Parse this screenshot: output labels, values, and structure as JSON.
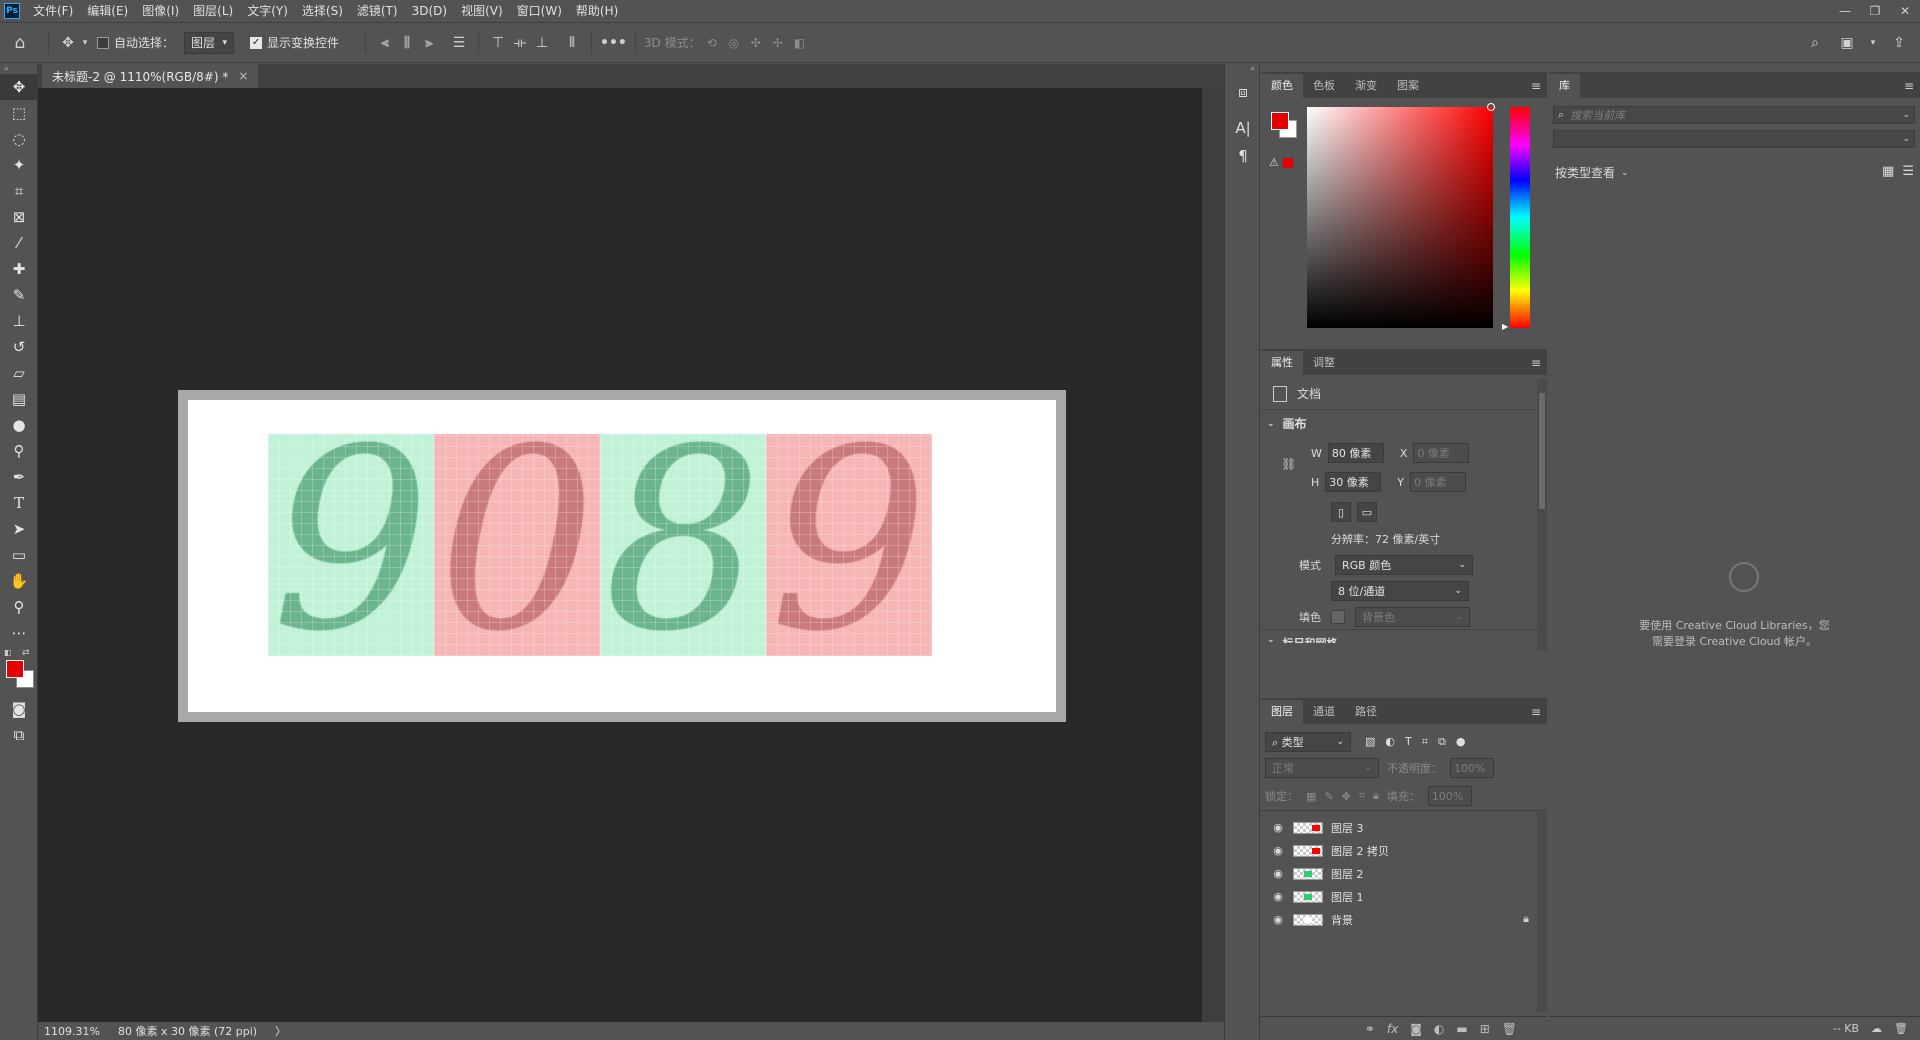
{
  "app": {
    "logo_text": "Ps"
  },
  "menu": [
    "文件(F)",
    "编辑(E)",
    "图像(I)",
    "图层(L)",
    "文字(Y)",
    "选择(S)",
    "滤镜(T)",
    "3D(D)",
    "视图(V)",
    "窗口(W)",
    "帮助(H)"
  ],
  "window_controls": [
    "—",
    "❐",
    "✕"
  ],
  "options": {
    "auto_select_label": "自动选择：",
    "auto_select_checked": false,
    "target_value": "图层",
    "show_transform_label": "显示变换控件",
    "show_transform_checked": true,
    "mode_3d_label": "3D 模式："
  },
  "document": {
    "tab_title": "未标题-2 @ 1110%(RGB/8#) *",
    "close": "×",
    "digits": [
      {
        "text": "9",
        "color": "#6bb58c",
        "fill": "#c1f2d8"
      },
      {
        "text": "0",
        "color": "#c97a7a",
        "fill": "#f6b6b6"
      },
      {
        "text": "8",
        "color": "#6bb58c",
        "fill": "#c1f2d8"
      },
      {
        "text": "9",
        "color": "#c97a7a",
        "fill": "#f6b6b6"
      }
    ]
  },
  "status": {
    "zoom": "1109.31%",
    "doc_info": "80 像素 x 30 像素 (72 ppi)",
    "arrow": "〉"
  },
  "color_panel": {
    "tabs": [
      "颜色",
      "色板",
      "渐变",
      "图案"
    ],
    "active_tab": 0,
    "fg": "#e60000",
    "bg": "#ffffff"
  },
  "properties": {
    "tabs": [
      "属性",
      "调整"
    ],
    "doc_label": "文档",
    "section_canvas": "画布",
    "w_label": "W",
    "w_value": "80 像素",
    "h_label": "H",
    "h_value": "30 像素",
    "x_label": "X",
    "x_value": "0 像素",
    "y_label": "Y",
    "y_value": "0 像素",
    "resolution": "分辨率：72 像素/英寸",
    "mode_label": "模式",
    "mode_value": "RGB 颜色",
    "depth_value": "8 位/通道",
    "fill_label": "填色",
    "fill_value": "背景色",
    "next_section": "标尺和网格"
  },
  "layers": {
    "tabs": [
      "图层",
      "通道",
      "路径"
    ],
    "filter_value": "类型",
    "blend_mode": "正常",
    "opacity_label": "不透明度：",
    "opacity_value": "100%",
    "lock_label": "锁定：",
    "fill_label": "填充：",
    "fill_value": "100%",
    "items": [
      {
        "name": "图层 3",
        "mark": "#ff0000",
        "locked": false
      },
      {
        "name": "图层 2 拷贝",
        "mark": "#ff0000",
        "locked": false
      },
      {
        "name": "图层 2",
        "mark": "#2ecc71",
        "locked": false
      },
      {
        "name": "图层 1",
        "mark": "#2ecc71",
        "locked": false
      },
      {
        "name": "背景",
        "mark": "#ffffff",
        "locked": true
      }
    ]
  },
  "library": {
    "tab": "库",
    "search_placeholder": "搜索当前库",
    "view_by": "按类型查看",
    "message_line1": "要使用 Creative Cloud Libraries，您",
    "message_line2": "需要登录 Creative Cloud 帐户。",
    "footer_size": "-- KB"
  }
}
